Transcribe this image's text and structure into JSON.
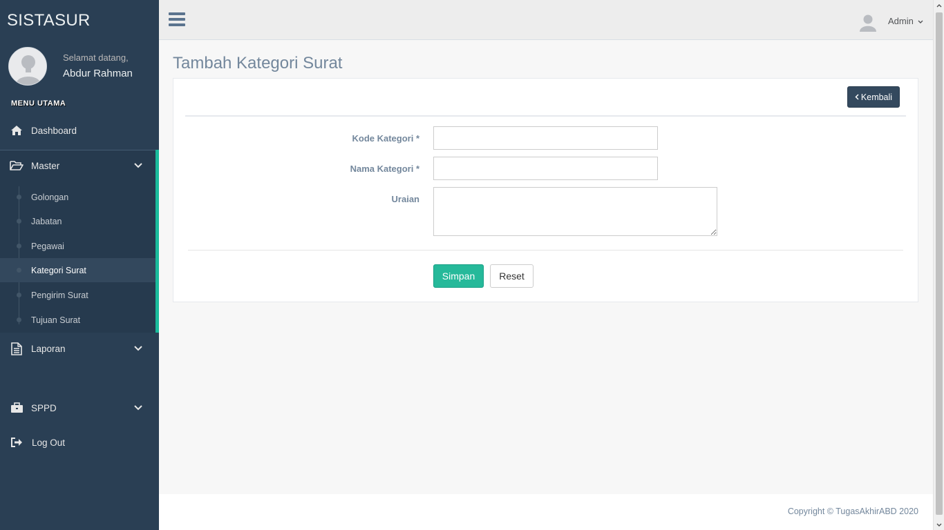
{
  "sidebar": {
    "brand": "SISTASUR",
    "welcome": "Selamat datang,",
    "username": "Abdur Rahman",
    "menu_heading": "MENU UTAMA",
    "items": {
      "dashboard": "Dashboard",
      "master": "Master",
      "laporan": "Laporan",
      "sppd": "SPPD",
      "logout": "Log Out"
    },
    "master_sub": [
      "Golongan",
      "Jabatan",
      "Pegawai",
      "Kategori Surat",
      "Pengirim Surat",
      "Tujuan Surat"
    ],
    "active_sub": "Kategori Surat"
  },
  "topnav": {
    "user_label": "Admin"
  },
  "page": {
    "title": "Tambah Kategori Surat",
    "back_label": "Kembali",
    "form": {
      "kode_label": "Kode Kategori *",
      "kode_value": "",
      "nama_label": "Nama Kategori *",
      "nama_value": "",
      "uraian_label": "Uraian",
      "uraian_value": ""
    },
    "save_label": "Simpan",
    "reset_label": "Reset"
  },
  "footer": {
    "copyright": "Copyright © TugasAkhirABD 2020"
  },
  "colors": {
    "sidebar_bg": "#2a3f54",
    "accent": "#1abb9c",
    "save_button": "#26b99a",
    "back_button": "#34495e"
  },
  "icons": {
    "dashboard": "home-icon",
    "master": "folder-open-icon",
    "laporan": "file-text-icon",
    "sppd": "briefcase-icon",
    "logout": "sign-out-icon"
  }
}
